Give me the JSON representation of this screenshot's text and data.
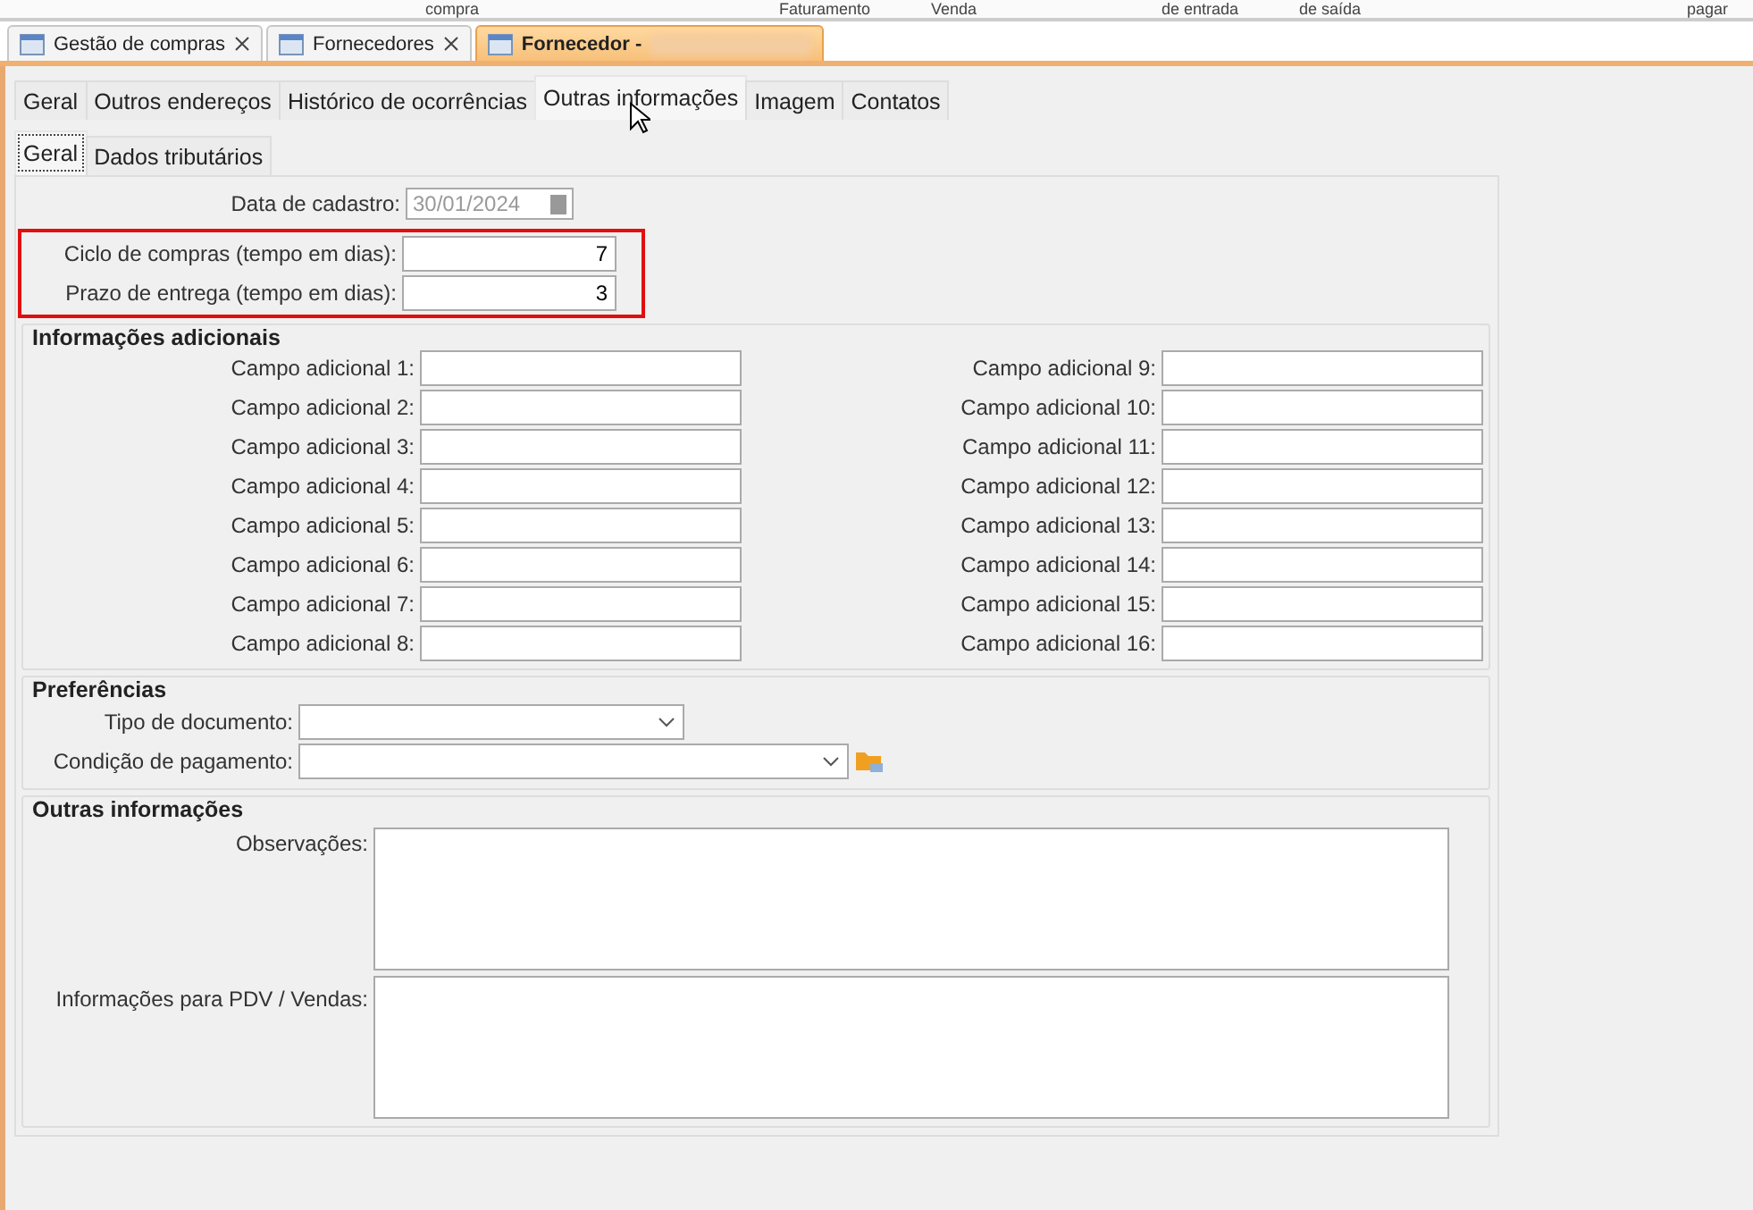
{
  "header_texts": [
    {
      "label": "compra"
    },
    {
      "label": "Faturamento"
    },
    {
      "label": "Venda"
    },
    {
      "label": "de entrada"
    },
    {
      "label": "de saída"
    },
    {
      "label": "pagar"
    }
  ],
  "document_tabs": [
    {
      "label": "Gestão de compras",
      "selected": false,
      "closable": true
    },
    {
      "label": "Fornecedores",
      "selected": false,
      "closable": true
    },
    {
      "label": "Fornecedor -",
      "selected": true,
      "closable": false
    }
  ],
  "tabs": [
    {
      "label": "Geral",
      "selected": false
    },
    {
      "label": "Outros endereços",
      "selected": false
    },
    {
      "label": "Histórico de ocorrências",
      "selected": false
    },
    {
      "label": "Outras informações",
      "selected": true
    },
    {
      "label": "Imagem",
      "selected": false
    },
    {
      "label": "Contatos",
      "selected": false
    }
  ],
  "sub_tabs": [
    {
      "label": "Geral",
      "selected": true
    },
    {
      "label": "Dados tributários",
      "selected": false
    }
  ],
  "registration_date": {
    "label": "Data de cadastro:",
    "value": "30/01/2024",
    "disabled": true
  },
  "highlighted_fields": [
    {
      "label": "Ciclo de compras (tempo em dias):",
      "value": "7"
    },
    {
      "label": "Prazo de entrega (tempo em dias):",
      "value": "3"
    }
  ],
  "additional_info": {
    "title": "Informações adicionais",
    "fields": [
      {
        "label": "Campo adicional 1:"
      },
      {
        "label": "Campo adicional 9:"
      },
      {
        "label": "Campo adicional 2:"
      },
      {
        "label": "Campo adicional 10:"
      },
      {
        "label": "Campo adicional 3:"
      },
      {
        "label": "Campo adicional 11:"
      },
      {
        "label": "Campo adicional 4:"
      },
      {
        "label": "Campo adicional 12:"
      },
      {
        "label": "Campo adicional 5:"
      },
      {
        "label": "Campo adicional 13:"
      },
      {
        "label": "Campo adicional 6:"
      },
      {
        "label": "Campo adicional 14:"
      },
      {
        "label": "Campo adicional 7:"
      },
      {
        "label": "Campo adicional 15:"
      },
      {
        "label": "Campo adicional 8:"
      },
      {
        "label": "Campo adicional 16:"
      }
    ]
  },
  "preferences": {
    "title": "Preferências",
    "fields": [
      {
        "label": "Tipo de documento:",
        "kind": "short"
      },
      {
        "label": "Condição de pagamento:",
        "kind": "long"
      }
    ]
  },
  "other_info": {
    "title": "Outras informações",
    "fields": [
      {
        "label": "Observações:"
      },
      {
        "label": "Informações para PDV / Vendas:"
      }
    ]
  }
}
